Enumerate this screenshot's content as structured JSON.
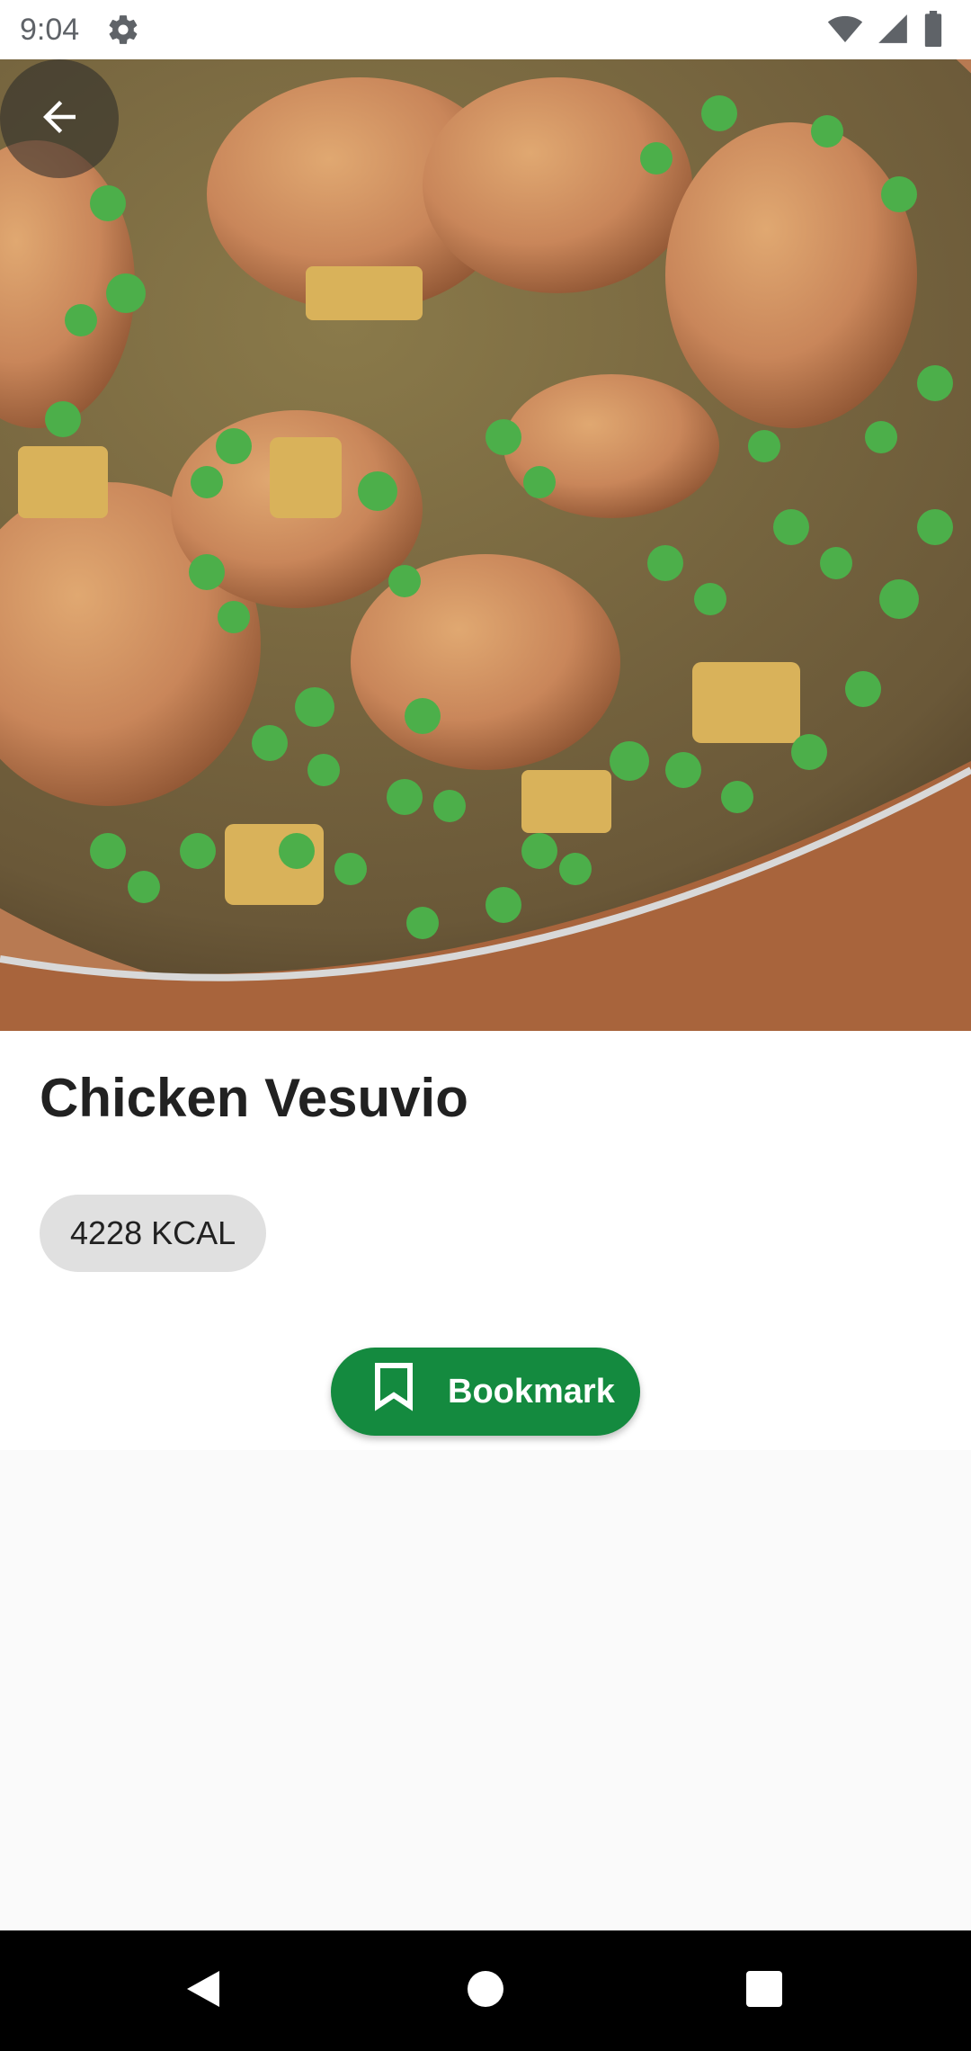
{
  "status_bar": {
    "time": "9:04",
    "icons": [
      "gear-icon",
      "wifi-icon",
      "signal-icon",
      "battery-icon"
    ]
  },
  "hero": {
    "image": "chicken-vesuvio-photo",
    "back_icon": "arrow-back-icon"
  },
  "recipe": {
    "title": "Chicken Vesuvio",
    "calories": "4228 KCAL"
  },
  "actions": {
    "bookmark_label": "Bookmark",
    "bookmark_icon": "bookmark-icon",
    "accent_color": "#148a3f"
  },
  "nav_bar": {
    "buttons": [
      "back-triangle-icon",
      "home-circle-icon",
      "recents-square-icon"
    ]
  }
}
